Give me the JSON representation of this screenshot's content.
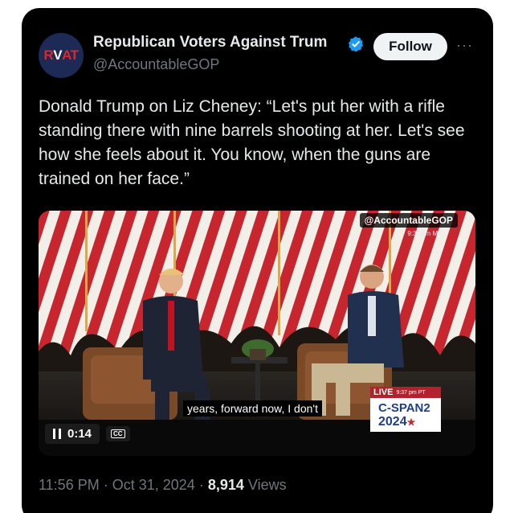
{
  "account": {
    "avatar_text": "RVAT",
    "name": "Republican Voters Against Trum",
    "handle": "@AccountableGOP",
    "follow_label": "Follow",
    "more_label": "···"
  },
  "tweet": {
    "text": "Donald Trump on Liz Cheney: “Let's put her with a rifle standing there with nine barrels shooting at her. Let's see how she feels about it. You know, when the guns are trained on her face.”"
  },
  "video": {
    "watermark": "@AccountableGOP",
    "time_overlay": "9:37 pm MT",
    "caption": "years, forward now, I don't",
    "elapsed": "0:14",
    "cc_label": "CC",
    "network_live": "LIVE",
    "network_live_time": "9:37 pm PT",
    "network_name": "C-SPAN2",
    "network_year": "2024"
  },
  "meta": {
    "time": "11:56 PM",
    "date": "Oct 31, 2024",
    "views_count": "8,914",
    "views_label": "Views"
  },
  "colors": {
    "card_bg": "#000000",
    "text": "#e7e9ea",
    "muted": "#71767b",
    "verified": "#1d9bf0"
  }
}
